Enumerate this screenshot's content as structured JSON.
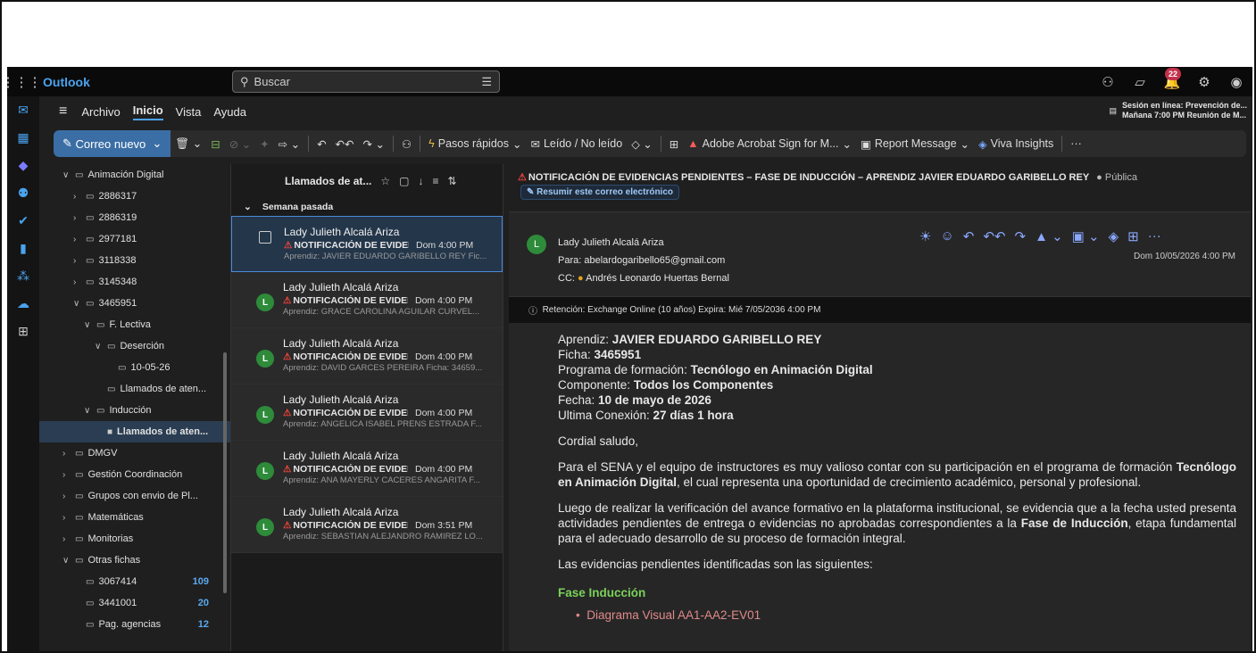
{
  "topbar": {
    "app_name": "Outlook",
    "search_placeholder": "Buscar",
    "notifications_count": "22"
  },
  "menu": {
    "archivo": "Archivo",
    "inicio": "Inicio",
    "vista": "Vista",
    "ayuda": "Ayuda"
  },
  "session": {
    "line1": "Sesión en línea: Prevención de...",
    "line2": "Mañana 7:00 PM Reunión de M..."
  },
  "ribbon": {
    "new_mail": "Correo nuevo",
    "quick_steps": "Pasos rápidos",
    "read_unread": "Leído / No leído",
    "adobe": "Adobe Acrobat Sign for M...",
    "report": "Report Message",
    "viva": "Viva Insights",
    "more": "···"
  },
  "folders": [
    {
      "label": "Animación Digital",
      "chev": "∨",
      "indent": 0
    },
    {
      "label": "2886317",
      "chev": "›",
      "indent": 1
    },
    {
      "label": "2886319",
      "chev": "›",
      "indent": 1
    },
    {
      "label": "2977181",
      "chev": "›",
      "indent": 1
    },
    {
      "label": "3118338",
      "chev": "›",
      "indent": 1
    },
    {
      "label": "3145348",
      "chev": "›",
      "indent": 1
    },
    {
      "label": "3465951",
      "chev": "∨",
      "indent": 1
    },
    {
      "label": "F. Lectiva",
      "chev": "∨",
      "indent": 2
    },
    {
      "label": "Deserción",
      "chev": "∨",
      "indent": 3
    },
    {
      "label": "10-05-26",
      "chev": "",
      "indent": 4
    },
    {
      "label": "Llamados de aten...",
      "chev": "",
      "indent": 3
    },
    {
      "label": "Inducción",
      "chev": "∨",
      "indent": 2
    },
    {
      "label": "Llamados de aten...",
      "chev": "",
      "indent": 3,
      "selected": true
    },
    {
      "label": "DMGV",
      "chev": "›",
      "indent": 0
    },
    {
      "label": "Gestión Coordinación",
      "chev": "›",
      "indent": 0
    },
    {
      "label": "Grupos con envio de Pl...",
      "chev": "›",
      "indent": 0
    },
    {
      "label": "Matemáticas",
      "chev": "›",
      "indent": 0
    },
    {
      "label": "Monitorias",
      "chev": "›",
      "indent": 0
    },
    {
      "label": "Otras fichas",
      "chev": "∨",
      "indent": 0
    },
    {
      "label": "3067414",
      "chev": "",
      "indent": 1,
      "count": "109"
    },
    {
      "label": "3441001",
      "chev": "",
      "indent": 1,
      "count": "20"
    },
    {
      "label": "Pag. agencias",
      "chev": "",
      "indent": 1,
      "count": "12"
    }
  ],
  "list": {
    "title": "Llamados de at...",
    "group": "Semana pasada"
  },
  "messages": [
    {
      "from": "Lady Julieth Alcalá Ariza",
      "subject": "NOTIFICACIÓN DE EVIDEN...",
      "time": "Dom 4:00 PM",
      "preview": "Aprendiz: JAVIER EDUARDO GARIBELLO REY Fic...",
      "selected": true
    },
    {
      "from": "Lady Julieth Alcalá Ariza",
      "subject": "NOTIFICACIÓN DE EVIDEN...",
      "time": "Dom 4:00 PM",
      "preview": "Aprendiz: GRACE CAROLINA AGUILAR CURVEL..."
    },
    {
      "from": "Lady Julieth Alcalá Ariza",
      "subject": "NOTIFICACIÓN DE EVIDEN...",
      "time": "Dom 4:00 PM",
      "preview": "Aprendiz: DAVID GARCES PEREIRA Ficha: 34659..."
    },
    {
      "from": "Lady Julieth Alcalá Ariza",
      "subject": "NOTIFICACIÓN DE EVIDEN...",
      "time": "Dom 4:00 PM",
      "preview": "Aprendiz: ANGELICA ISABEL PRENS ESTRADA F..."
    },
    {
      "from": "Lady Julieth Alcalá Ariza",
      "subject": "NOTIFICACIÓN DE EVIDEN...",
      "time": "Dom 4:00 PM",
      "preview": "Aprendiz: ANA MAYERLY CACERES ANGARITA F..."
    },
    {
      "from": "Lady Julieth Alcalá Ariza",
      "subject": "NOTIFICACIÓN DE EVIDEN...",
      "time": "Dom 3:51 PM",
      "preview": "Aprendiz: SEBASTIAN ALEJANDRO RAMIREZ LO..."
    }
  ],
  "reading": {
    "subject": "NOTIFICACIÓN DE EVIDENCIAS PENDIENTES – FASE DE INDUCCIÓN – APRENDIZ JAVIER EDUARDO GARIBELLO REY",
    "sensitivity": "Pública",
    "summarize": "Resumir este correo electrónico",
    "sender": "Lady Julieth Alcalá Ariza",
    "to": "Para:  abelardogaribello65@gmail.com",
    "cc_label": "CC:",
    "cc": "Andrés Leonardo Huertas Bernal",
    "date": "Dom 10/05/2026 4:00 PM",
    "retention": "Retención: Exchange Online (10 años) Expira: Mié 7/05/2036 4:00 PM",
    "aprendiz_label": "Aprendiz: ",
    "aprendiz": "JAVIER EDUARDO GARIBELLO REY",
    "ficha_label": "Ficha: ",
    "ficha": "3465951",
    "programa_label": "Programa de formación: ",
    "programa": "Tecnólogo en Animación Digital",
    "componente_label": "Componente: ",
    "componente": "Todos los Componentes",
    "fecha_label": "Fecha: ",
    "fecha": "10 de mayo de 2026",
    "conexion_label": "Ultima Conexión: ",
    "conexion": "27 días 1 hora",
    "greeting": "Cordial saludo,",
    "p1a": "Para el SENA y el equipo de instructores es muy valioso contar con su participación en el programa de formación ",
    "p1b": "Tecnólogo en Animación Digital",
    "p1c": ", el cual representa una oportunidad de crecimiento académico, personal y profesional.",
    "p2a": "Luego de realizar la verificación del avance formativo en la plataforma institucional, se evidencia que a la fecha usted presenta actividades pendientes de entrega o evidencias no aprobadas correspondientes a la ",
    "p2b": "Fase de Inducción",
    "p2c": ", etapa fundamental para el adecuado desarrollo de su proceso de formación integral.",
    "p3": "Las evidencias pendientes identificadas son las siguientes:",
    "phase": "Fase Inducción",
    "evidence1": "Diagrama Visual AA1-AA2-EV01"
  }
}
